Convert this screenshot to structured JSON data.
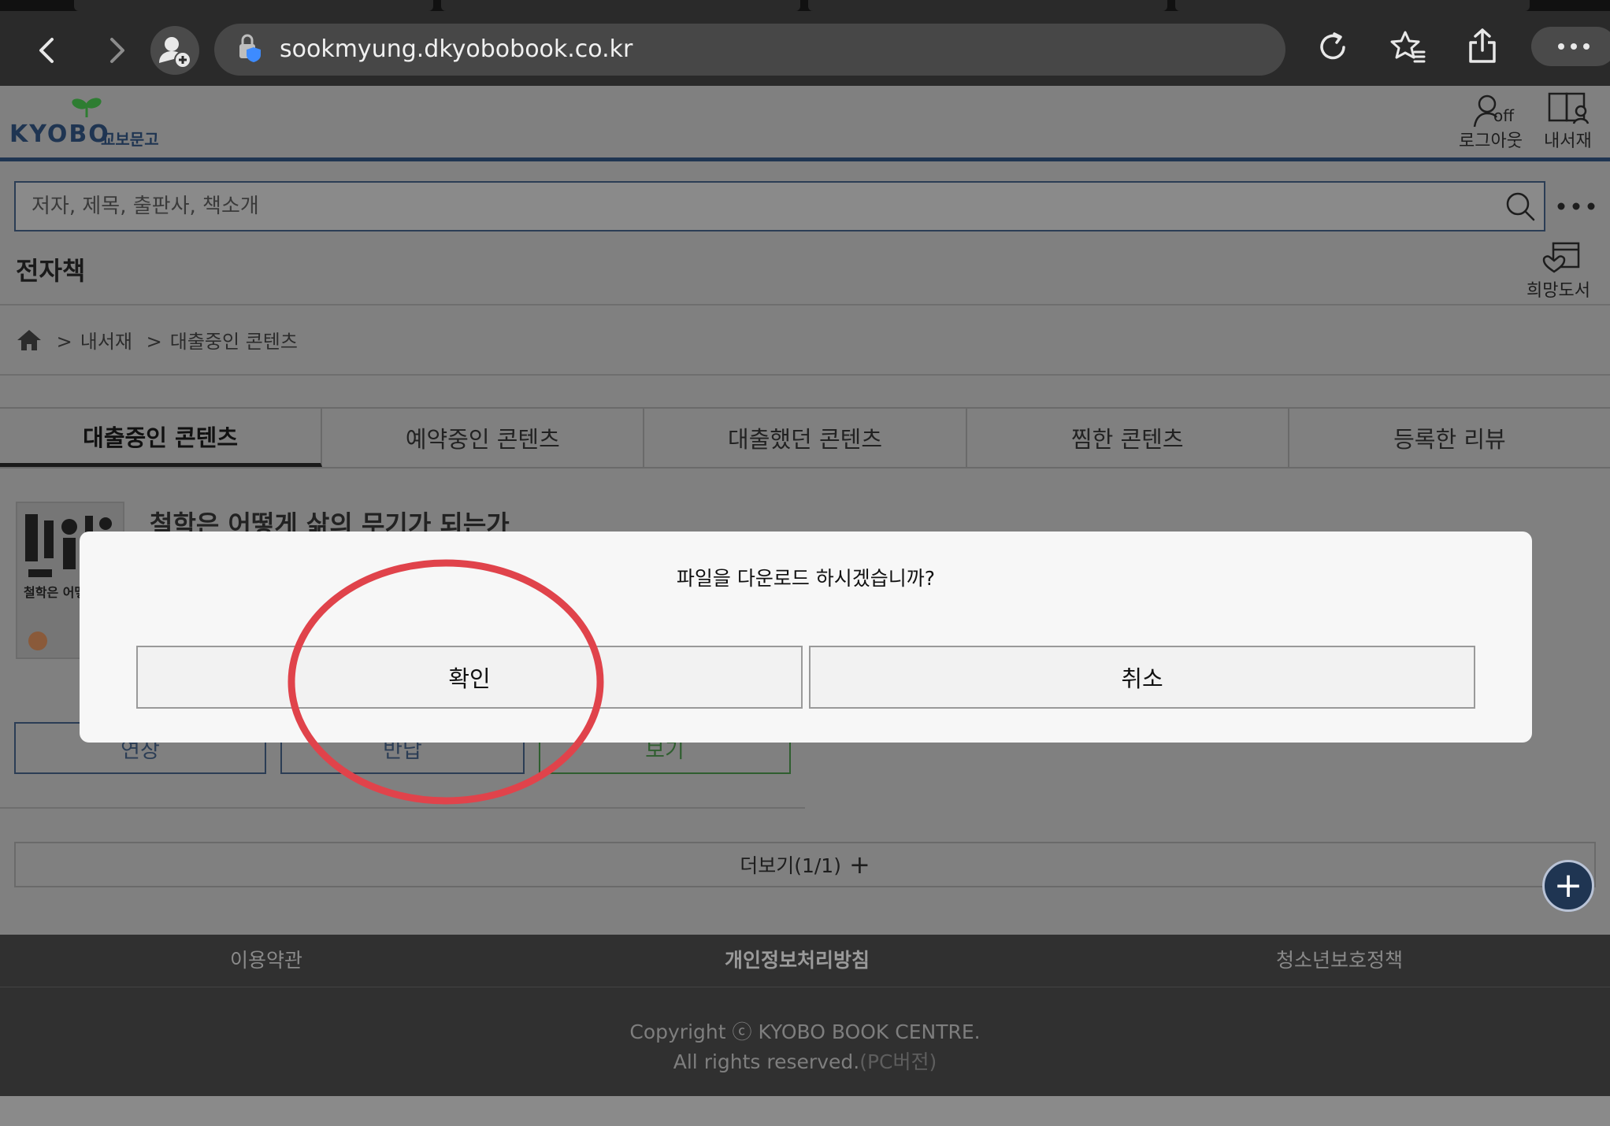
{
  "browser": {
    "url": "sookmyung.dkyobobook.co.kr",
    "icons": [
      "back-icon",
      "forward-icon",
      "profile-add-icon",
      "site-shield-icon",
      "reload-icon",
      "favorites-icon",
      "share-icon",
      "more-icon"
    ]
  },
  "header": {
    "logo_text": "KYOBO",
    "logo_sub": "교보문고",
    "logout_label": "로그아웃",
    "logout_badge": "off",
    "mylibrary_label": "내서재",
    "wish_label": "희망도서"
  },
  "search": {
    "placeholder": "저자, 제목, 출판사, 책소개"
  },
  "section": {
    "title": "전자책"
  },
  "breadcrumb": {
    "sep": ">",
    "items": [
      "내서재",
      "대출중인 콘텐츠"
    ]
  },
  "tabs": [
    {
      "label": "대출중인 콘텐츠",
      "active": true
    },
    {
      "label": "예약중인 콘텐츠"
    },
    {
      "label": "대출했던 콘텐츠"
    },
    {
      "label": "찜한 콘텐츠"
    },
    {
      "label": "등록한 리뷰"
    }
  ],
  "book": {
    "title": "철학은 어떻게 삶의 무기가 되는가",
    "cover_text": "철학은 어떻게 삶의"
  },
  "actions": {
    "extend": "연장",
    "return": "반납",
    "view": "보기"
  },
  "more": {
    "label": "더보기(1/1)",
    "plus": "+"
  },
  "footer": {
    "links": [
      "이용약관",
      "개인정보처리방침",
      "청소년보호정책"
    ],
    "copyright": "Copyright ⓒ KYOBO BOOK CENTRE.",
    "rights": "All rights reserved.",
    "pc_version": "(PC버전)"
  },
  "fab": {
    "symbol": "+"
  },
  "dialog": {
    "message": "파일을 다운로드 하시겠습니까?",
    "confirm": "확인",
    "cancel": "취소"
  },
  "colors": {
    "brand_navy": "#1f3552",
    "brand_green": "#2e8b3a",
    "annotation_ring": "#e0434b"
  }
}
